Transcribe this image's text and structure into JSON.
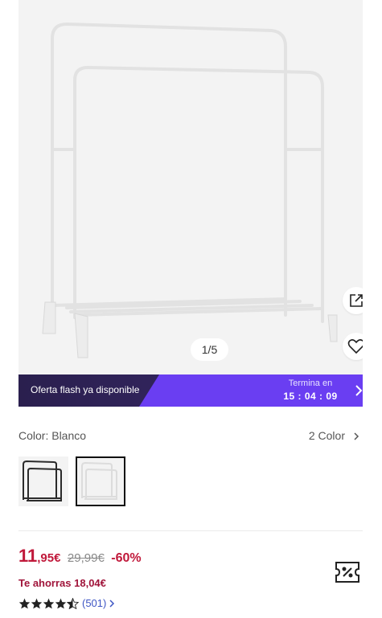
{
  "gallery": {
    "counter": "1/5",
    "share_icon": "external-link-icon",
    "favorite_icon": "heart-icon"
  },
  "flash_sale": {
    "label": "Oferta flash ya disponible",
    "ends_label": "Termina en",
    "timer": "15 : 04 : 09",
    "colors": {
      "start": "#2a1f4e",
      "end": "#6a3ef2"
    }
  },
  "variant": {
    "color_label": "Color: Blanco",
    "count_label": "2 Color",
    "swatches": [
      {
        "name": "Negro",
        "selected": false
      },
      {
        "name": "Blanco",
        "selected": true
      }
    ]
  },
  "price": {
    "integer": "11",
    "decimal": ",95€",
    "original": "29,99€",
    "discount": "-60%",
    "savings": "Te ahorras 18,04€",
    "rating": 4.5,
    "reviews": "(501)",
    "colors": {
      "sale": "#c0183a",
      "reviews": "#3d55c4"
    }
  },
  "coupon_icon": "coupon-icon"
}
